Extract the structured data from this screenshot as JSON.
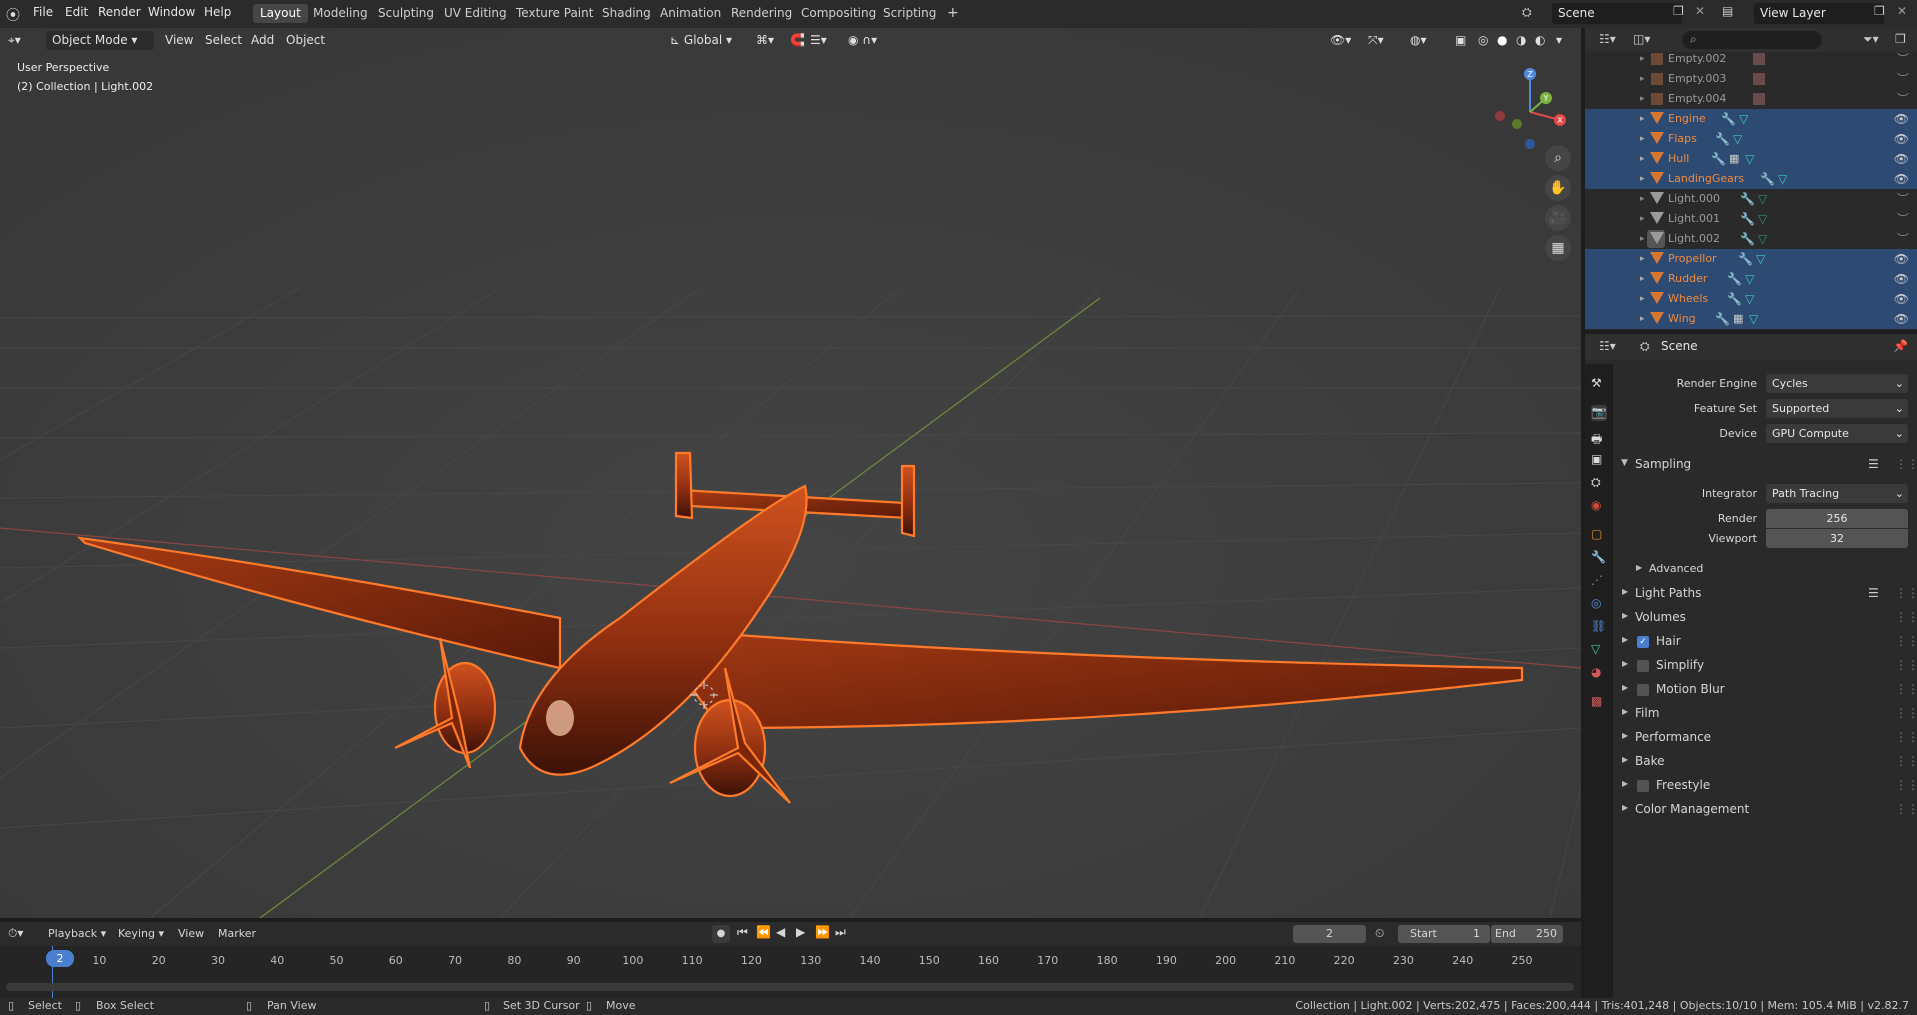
{
  "topbar": {
    "menus": [
      "File",
      "Edit",
      "Render",
      "Window",
      "Help"
    ],
    "workspaces": [
      {
        "label": "Layout",
        "active": true
      },
      {
        "label": "Modeling"
      },
      {
        "label": "Sculpting"
      },
      {
        "label": "UV Editing"
      },
      {
        "label": "Texture Paint"
      },
      {
        "label": "Shading"
      },
      {
        "label": "Animation"
      },
      {
        "label": "Rendering"
      },
      {
        "label": "Compositing"
      },
      {
        "label": "Scripting"
      }
    ],
    "add_workspace": "+",
    "scene_name": "Scene",
    "view_layer_name": "View Layer"
  },
  "viewport": {
    "mode": "Object Mode",
    "menus": [
      "View",
      "Select",
      "Add",
      "Object"
    ],
    "orientation": "Global",
    "overlay_title": "User Perspective",
    "overlay_subtitle": "(2) Collection | Light.002",
    "gizmo_axes": {
      "x": "X",
      "y": "Y",
      "z": "Z"
    }
  },
  "outliner": {
    "search_placeholder": "",
    "rows": [
      {
        "name": "Empty.002",
        "selected": false,
        "kind": "empty"
      },
      {
        "name": "Empty.003",
        "selected": false,
        "kind": "empty"
      },
      {
        "name": "Empty.004",
        "selected": false,
        "kind": "empty"
      },
      {
        "name": "Engine",
        "selected": true,
        "kind": "mesh"
      },
      {
        "name": "Flaps",
        "selected": true,
        "kind": "mesh"
      },
      {
        "name": "Hull",
        "selected": true,
        "kind": "mesh"
      },
      {
        "name": "LandingGears",
        "selected": true,
        "kind": "mesh"
      },
      {
        "name": "Light.000",
        "selected": false,
        "kind": "mesh"
      },
      {
        "name": "Light.001",
        "selected": false,
        "kind": "mesh"
      },
      {
        "name": "Light.002",
        "selected": false,
        "kind": "mesh"
      },
      {
        "name": "Propellor",
        "selected": true,
        "kind": "mesh"
      },
      {
        "name": "Rudder",
        "selected": true,
        "kind": "mesh"
      },
      {
        "name": "Wheels",
        "selected": true,
        "kind": "mesh"
      },
      {
        "name": "Wing",
        "selected": true,
        "kind": "mesh"
      }
    ]
  },
  "properties": {
    "context": "Scene",
    "render_engine_label": "Render Engine",
    "render_engine_value": "Cycles",
    "feature_set_label": "Feature Set",
    "feature_set_value": "Supported",
    "device_label": "Device",
    "device_value": "GPU Compute",
    "sampling": {
      "title": "Sampling",
      "integrator_label": "Integrator",
      "integrator_value": "Path Tracing",
      "render_label": "Render",
      "render_value": "256",
      "viewport_label": "Viewport",
      "viewport_value": "32",
      "advanced": "Advanced"
    },
    "panels": [
      {
        "label": "Light Paths",
        "checkbox": null
      },
      {
        "label": "Volumes",
        "checkbox": null
      },
      {
        "label": "Hair",
        "checkbox": true
      },
      {
        "label": "Simplify",
        "checkbox": false
      },
      {
        "label": "Motion Blur",
        "checkbox": false
      },
      {
        "label": "Film",
        "checkbox": null
      },
      {
        "label": "Performance",
        "checkbox": null
      },
      {
        "label": "Bake",
        "checkbox": null
      },
      {
        "label": "Freestyle",
        "checkbox": false
      },
      {
        "label": "Color Management",
        "checkbox": null
      }
    ]
  },
  "timeline": {
    "menus": [
      "Playback",
      "Keying",
      "View",
      "Marker"
    ],
    "current_frame": "2",
    "start_label": "Start",
    "start_value": "1",
    "end_label": "End",
    "end_value": "250",
    "ticks": [
      "2",
      "10",
      "20",
      "30",
      "40",
      "50",
      "60",
      "70",
      "80",
      "90",
      "100",
      "110",
      "120",
      "130",
      "140",
      "150",
      "160",
      "170",
      "180",
      "190",
      "200",
      "210",
      "220",
      "230",
      "240",
      "250"
    ]
  },
  "statusbar": {
    "select": "Select",
    "box_select": "Box Select",
    "pan_view": "Pan View",
    "set_cursor": "Set 3D Cursor",
    "move": "Move",
    "stats": "Collection | Light.002 | Verts:202,475 | Faces:200,444 | Tris:401,248 | Objects:10/10 | Mem: 105.4 MiB | v2.82.7"
  },
  "colors": {
    "selection_highlight": "#2d4a73",
    "object_orange": "#e87d2c",
    "accent_blue": "#4a7fd0"
  }
}
